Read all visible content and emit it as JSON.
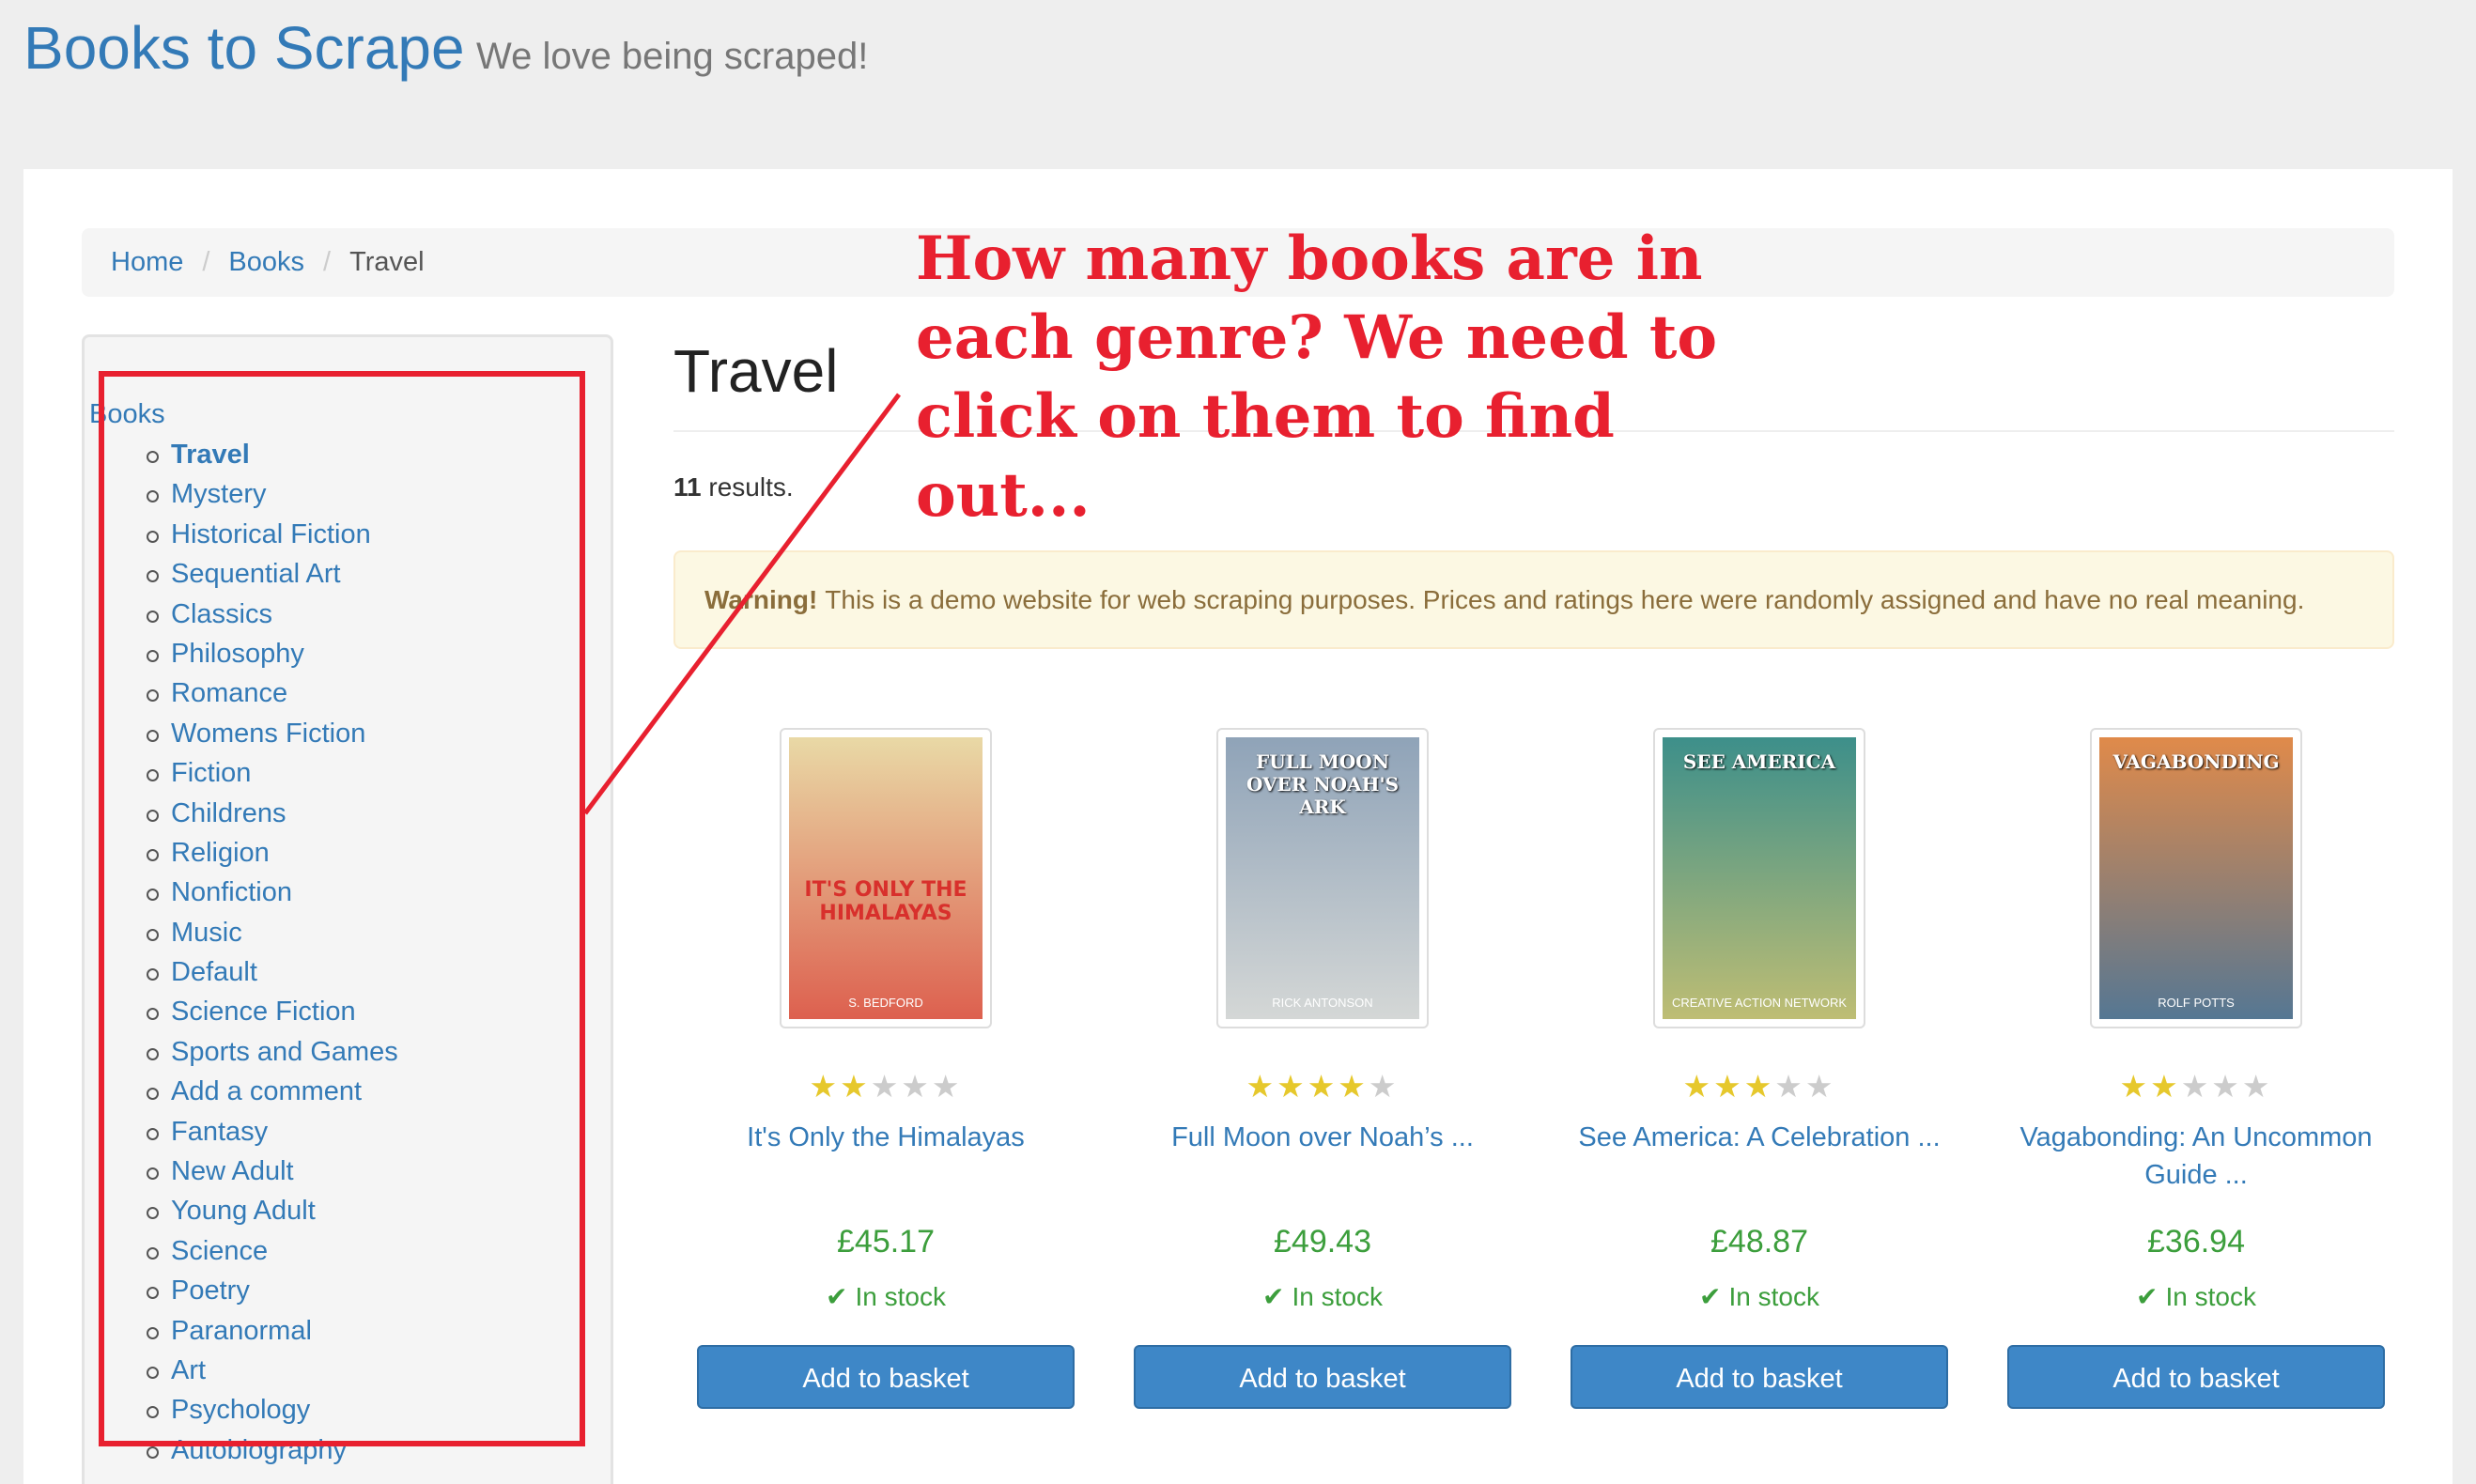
{
  "header": {
    "brand": "Books to Scrape",
    "tagline": "We love being scraped!"
  },
  "breadcrumb": {
    "home": "Home",
    "books": "Books",
    "current": "Travel"
  },
  "sidebar": {
    "title": "Books",
    "categories": [
      "Travel",
      "Mystery",
      "Historical Fiction",
      "Sequential Art",
      "Classics",
      "Philosophy",
      "Romance",
      "Womens Fiction",
      "Fiction",
      "Childrens",
      "Religion",
      "Nonfiction",
      "Music",
      "Default",
      "Science Fiction",
      "Sports and Games",
      "Add a comment",
      "Fantasy",
      "New Adult",
      "Young Adult",
      "Science",
      "Poetry",
      "Paranormal",
      "Art",
      "Psychology",
      "Autobiography"
    ]
  },
  "main": {
    "title": "Travel",
    "results_count": "11",
    "results_label": "results.",
    "alert_strong": "Warning!",
    "alert_text": "This is a demo website for web scraping purposes. Prices and ratings here were randomly assigned and have no real meaning."
  },
  "annotation": {
    "lines": [
      "How many books are in",
      "each genre? We need to",
      "click on them to find out..."
    ],
    "color": "#e8202f"
  },
  "products": [
    {
      "title": "It's Only the Himalayas",
      "rating": 2,
      "price": "£45.17",
      "stock": "In stock",
      "button": "Add to basket"
    },
    {
      "title": "Full Moon over Noah’s ...",
      "rating": 4,
      "price": "£49.43",
      "stock": "In stock",
      "button": "Add to basket"
    },
    {
      "title": "See America: A Celebration ...",
      "rating": 3,
      "price": "£48.87",
      "stock": "In stock",
      "button": "Add to basket"
    },
    {
      "title": "Vagabonding: An Uncommon Guide ...",
      "rating": 2,
      "price": "£36.94",
      "stock": "In stock",
      "button": "Add to basket"
    }
  ],
  "covers": [
    {
      "top_text": "",
      "title_text": "IT'S ONLY THE HIMALAYAS",
      "author_text": "S. BEDFORD",
      "bg": "#e9d9a6",
      "accent": "#d8302c"
    },
    {
      "top_text": "FULL MOON OVER NOAH'S ARK",
      "title_text": "",
      "author_text": "RICK ANTONSON",
      "bg": "#8fa3b8",
      "accent": "#f0ece2"
    },
    {
      "top_text": "SEE AMERICA",
      "title_text": "",
      "author_text": "CREATIVE ACTION NETWORK",
      "bg": "#3d8f8a",
      "accent": "#f2d06b"
    },
    {
      "top_text": "VAGABONDING",
      "title_text": "",
      "author_text": "ROLF POTTS",
      "bg": "#e08a4a",
      "accent": "#1e6fb0"
    }
  ]
}
